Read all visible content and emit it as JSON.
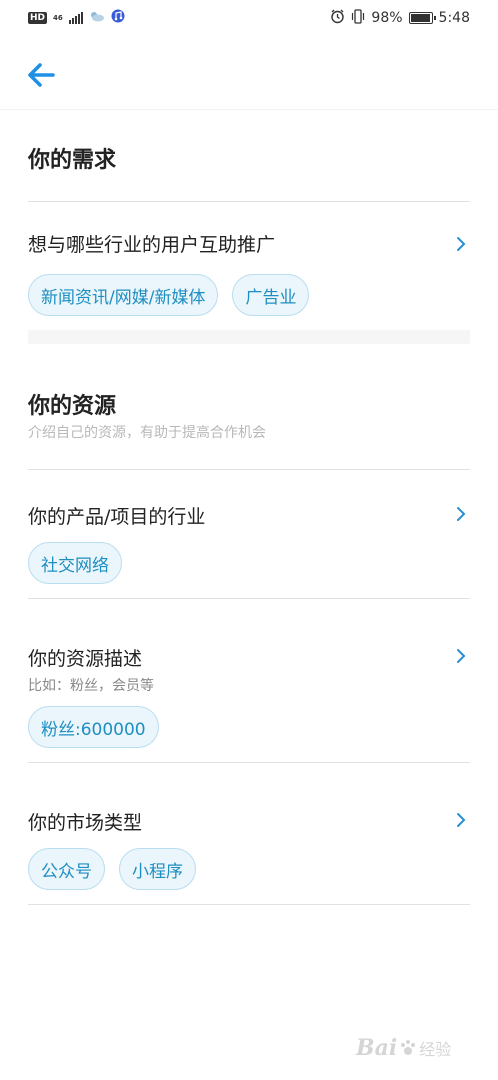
{
  "status_bar": {
    "left_badge": "HD",
    "network": "46",
    "battery_pct": "98%",
    "battery_level": 0.98,
    "time": "5:48"
  },
  "header": {
    "back_icon": "arrow-left-icon"
  },
  "demand_section": {
    "title": "你的需求",
    "rows": [
      {
        "label": "想与哪些行业的用户互助推广",
        "tags": [
          "新闻资讯/网媒/新媒体",
          "广告业"
        ]
      }
    ]
  },
  "resource_section": {
    "title": "你的资源",
    "subtitle": "介绍自己的资源，有助于提高合作机会",
    "rows": [
      {
        "label": "你的产品/项目的行业",
        "tags": [
          "社交网络"
        ]
      },
      {
        "label": "你的资源描述",
        "hint": "比如：粉丝，会员等",
        "tags": [
          "粉丝:600000"
        ]
      },
      {
        "label": "你的市场类型",
        "tags": [
          "公众号",
          "小程序"
        ]
      }
    ]
  },
  "colors": {
    "accent": "#1f8ec2",
    "tag_bg": "#eaf6fb",
    "tag_border": "#b9def0",
    "back_arrow": "#1e90e6",
    "chevron": "#2a8fd0"
  },
  "watermark": {
    "text": "Bai",
    "sub": "经验"
  }
}
